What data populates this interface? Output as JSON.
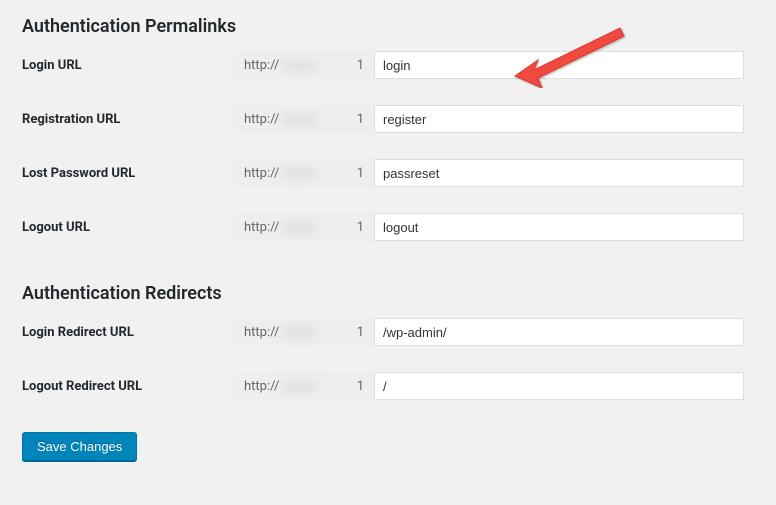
{
  "sections": {
    "permalinks": {
      "title": "Authentication Permalinks",
      "rows": {
        "login_url": {
          "label": "Login URL",
          "prefix_start": "http://",
          "prefix_end": "1",
          "value": "login"
        },
        "registration_url": {
          "label": "Registration URL",
          "prefix_start": "http://",
          "prefix_end": "1",
          "value": "register"
        },
        "lost_password_url": {
          "label": "Lost Password URL",
          "prefix_start": "http://",
          "prefix_end": "1",
          "value": "passreset"
        },
        "logout_url": {
          "label": "Logout URL",
          "prefix_start": "http://",
          "prefix_end": "1",
          "value": "logout"
        }
      }
    },
    "redirects": {
      "title": "Authentication Redirects",
      "rows": {
        "login_redirect_url": {
          "label": "Login Redirect URL",
          "prefix_start": "http://",
          "prefix_end": "1",
          "value": "/wp-admin/"
        },
        "logout_redirect_url": {
          "label": "Logout Redirect URL",
          "prefix_start": "http://",
          "prefix_end": "1",
          "value": "/"
        }
      }
    }
  },
  "save_button_label": "Save Changes"
}
